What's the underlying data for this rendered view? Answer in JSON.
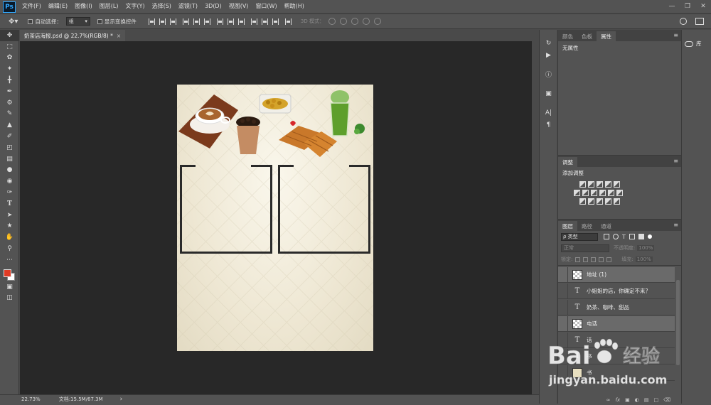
{
  "app": {
    "logo": "Ps",
    "menus": [
      "文件(F)",
      "编辑(E)",
      "图像(I)",
      "图层(L)",
      "文字(Y)",
      "选择(S)",
      "滤镜(T)",
      "3D(D)",
      "视图(V)",
      "窗口(W)",
      "帮助(H)"
    ]
  },
  "options": {
    "auto_select_label": "自动选择：",
    "auto_select_value": "组",
    "show_transform_label": "显示变换控件",
    "mode_3d_label": "3D 模式："
  },
  "document": {
    "tab_title": "奶茶店海报.psd @ 22.7%(RGB/8) *",
    "close": "×"
  },
  "status": {
    "zoom": "22.73%",
    "doc_info": "文档:15.5M/67.3M",
    "arrow": "›"
  },
  "panels": {
    "properties": {
      "tabs": [
        "颜色",
        "色板",
        "属性"
      ],
      "active": 2,
      "content": "无属性"
    },
    "adjustments": {
      "tab": "调整",
      "subtitle": "添加调整"
    },
    "layers": {
      "tabs": [
        "图层",
        "路径",
        "通道"
      ],
      "active": 0,
      "filter_kind": "ρ 类型",
      "blend_mode": "正常",
      "opacity_label": "不透明度:",
      "opacity_value": "100%",
      "lock_label": "锁定:",
      "fill_label": "填充:",
      "fill_value": "100%",
      "items": [
        {
          "name": "地址 (1)",
          "type": "image",
          "highlighted": true
        },
        {
          "name": "小姐姐的店，你确定不来？",
          "type": "text",
          "highlighted": false
        },
        {
          "name": "奶茶、咖啡、甜品",
          "type": "text",
          "highlighted": false
        },
        {
          "name": "电话",
          "type": "image",
          "highlighted": true
        },
        {
          "name": "话",
          "type": "text",
          "highlighted": false
        },
        {
          "name": "书",
          "type": "text",
          "highlighted": false
        },
        {
          "name": "书",
          "type": "image",
          "highlighted": false
        }
      ]
    }
  },
  "library_label": "库",
  "watermark": {
    "brand": "Bai",
    "brand_cn": "经验",
    "url": "jingyan.baidu.com"
  },
  "colors": {
    "foreground": "#e03b25",
    "background": "#ffffff",
    "accent": "#31a8ff"
  }
}
